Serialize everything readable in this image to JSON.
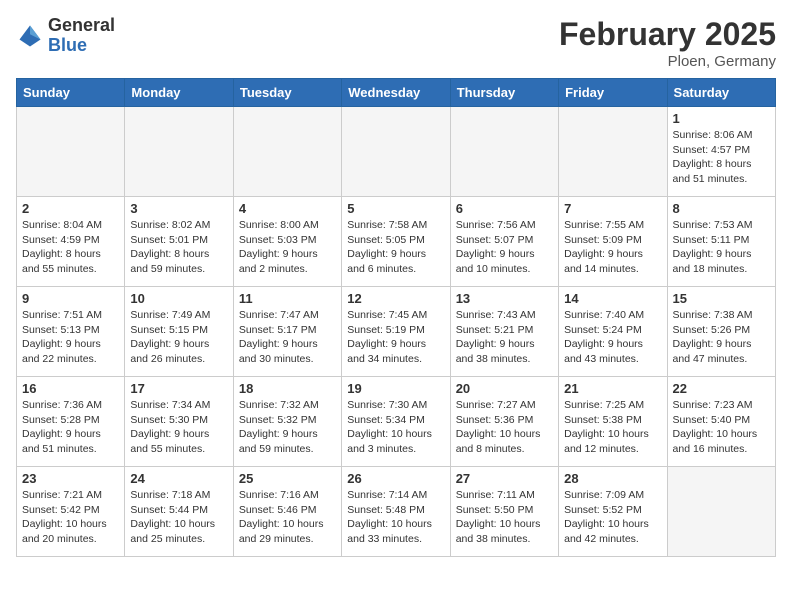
{
  "header": {
    "logo_general": "General",
    "logo_blue": "Blue",
    "month_title": "February 2025",
    "location": "Ploen, Germany"
  },
  "days_of_week": [
    "Sunday",
    "Monday",
    "Tuesday",
    "Wednesday",
    "Thursday",
    "Friday",
    "Saturday"
  ],
  "weeks": [
    [
      {
        "day": "",
        "info": ""
      },
      {
        "day": "",
        "info": ""
      },
      {
        "day": "",
        "info": ""
      },
      {
        "day": "",
        "info": ""
      },
      {
        "day": "",
        "info": ""
      },
      {
        "day": "",
        "info": ""
      },
      {
        "day": "1",
        "info": "Sunrise: 8:06 AM\nSunset: 4:57 PM\nDaylight: 8 hours and 51 minutes."
      }
    ],
    [
      {
        "day": "2",
        "info": "Sunrise: 8:04 AM\nSunset: 4:59 PM\nDaylight: 8 hours and 55 minutes."
      },
      {
        "day": "3",
        "info": "Sunrise: 8:02 AM\nSunset: 5:01 PM\nDaylight: 8 hours and 59 minutes."
      },
      {
        "day": "4",
        "info": "Sunrise: 8:00 AM\nSunset: 5:03 PM\nDaylight: 9 hours and 2 minutes."
      },
      {
        "day": "5",
        "info": "Sunrise: 7:58 AM\nSunset: 5:05 PM\nDaylight: 9 hours and 6 minutes."
      },
      {
        "day": "6",
        "info": "Sunrise: 7:56 AM\nSunset: 5:07 PM\nDaylight: 9 hours and 10 minutes."
      },
      {
        "day": "7",
        "info": "Sunrise: 7:55 AM\nSunset: 5:09 PM\nDaylight: 9 hours and 14 minutes."
      },
      {
        "day": "8",
        "info": "Sunrise: 7:53 AM\nSunset: 5:11 PM\nDaylight: 9 hours and 18 minutes."
      }
    ],
    [
      {
        "day": "9",
        "info": "Sunrise: 7:51 AM\nSunset: 5:13 PM\nDaylight: 9 hours and 22 minutes."
      },
      {
        "day": "10",
        "info": "Sunrise: 7:49 AM\nSunset: 5:15 PM\nDaylight: 9 hours and 26 minutes."
      },
      {
        "day": "11",
        "info": "Sunrise: 7:47 AM\nSunset: 5:17 PM\nDaylight: 9 hours and 30 minutes."
      },
      {
        "day": "12",
        "info": "Sunrise: 7:45 AM\nSunset: 5:19 PM\nDaylight: 9 hours and 34 minutes."
      },
      {
        "day": "13",
        "info": "Sunrise: 7:43 AM\nSunset: 5:21 PM\nDaylight: 9 hours and 38 minutes."
      },
      {
        "day": "14",
        "info": "Sunrise: 7:40 AM\nSunset: 5:24 PM\nDaylight: 9 hours and 43 minutes."
      },
      {
        "day": "15",
        "info": "Sunrise: 7:38 AM\nSunset: 5:26 PM\nDaylight: 9 hours and 47 minutes."
      }
    ],
    [
      {
        "day": "16",
        "info": "Sunrise: 7:36 AM\nSunset: 5:28 PM\nDaylight: 9 hours and 51 minutes."
      },
      {
        "day": "17",
        "info": "Sunrise: 7:34 AM\nSunset: 5:30 PM\nDaylight: 9 hours and 55 minutes."
      },
      {
        "day": "18",
        "info": "Sunrise: 7:32 AM\nSunset: 5:32 PM\nDaylight: 9 hours and 59 minutes."
      },
      {
        "day": "19",
        "info": "Sunrise: 7:30 AM\nSunset: 5:34 PM\nDaylight: 10 hours and 3 minutes."
      },
      {
        "day": "20",
        "info": "Sunrise: 7:27 AM\nSunset: 5:36 PM\nDaylight: 10 hours and 8 minutes."
      },
      {
        "day": "21",
        "info": "Sunrise: 7:25 AM\nSunset: 5:38 PM\nDaylight: 10 hours and 12 minutes."
      },
      {
        "day": "22",
        "info": "Sunrise: 7:23 AM\nSunset: 5:40 PM\nDaylight: 10 hours and 16 minutes."
      }
    ],
    [
      {
        "day": "23",
        "info": "Sunrise: 7:21 AM\nSunset: 5:42 PM\nDaylight: 10 hours and 20 minutes."
      },
      {
        "day": "24",
        "info": "Sunrise: 7:18 AM\nSunset: 5:44 PM\nDaylight: 10 hours and 25 minutes."
      },
      {
        "day": "25",
        "info": "Sunrise: 7:16 AM\nSunset: 5:46 PM\nDaylight: 10 hours and 29 minutes."
      },
      {
        "day": "26",
        "info": "Sunrise: 7:14 AM\nSunset: 5:48 PM\nDaylight: 10 hours and 33 minutes."
      },
      {
        "day": "27",
        "info": "Sunrise: 7:11 AM\nSunset: 5:50 PM\nDaylight: 10 hours and 38 minutes."
      },
      {
        "day": "28",
        "info": "Sunrise: 7:09 AM\nSunset: 5:52 PM\nDaylight: 10 hours and 42 minutes."
      },
      {
        "day": "",
        "info": ""
      }
    ]
  ]
}
